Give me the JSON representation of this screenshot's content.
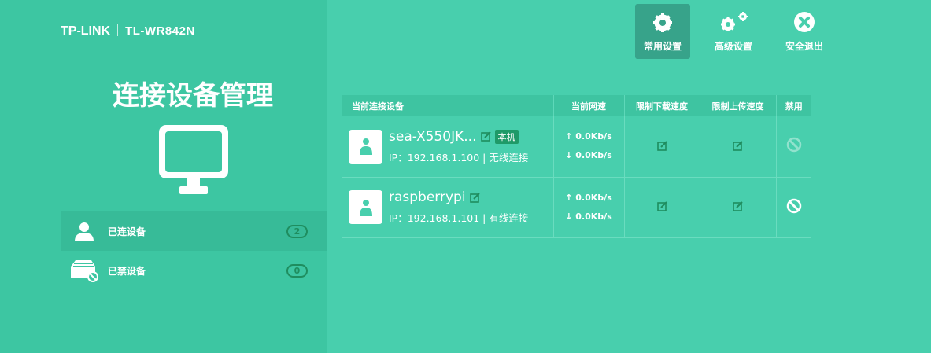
{
  "header": {
    "brand": "TP-LINK",
    "model": "TL-WR842N"
  },
  "sidebar": {
    "title": "连接设备管理",
    "items": [
      {
        "label": "已连设备",
        "count": "2"
      },
      {
        "label": "已禁设备",
        "count": "0"
      }
    ]
  },
  "topnav": [
    {
      "label": "常用设置"
    },
    {
      "label": "高级设置"
    },
    {
      "label": "安全退出"
    }
  ],
  "table": {
    "headers": [
      "当前连接设备",
      "当前网速",
      "限制下载速度",
      "限制上传速度",
      "禁用"
    ],
    "rows": [
      {
        "name": "sea-X550JK...",
        "tag": "本机",
        "ip": "IP：192.168.1.100 | 无线连接",
        "up": "↑ 0.0Kb/s",
        "down": "↓ 0.0Kb/s",
        "blocked_enabled": false
      },
      {
        "name": "raspberrypi",
        "tag": "",
        "ip": "IP：192.168.1.101 | 有线连接",
        "up": "↑ 0.0Kb/s",
        "down": "↓ 0.0Kb/s",
        "blocked_enabled": true
      }
    ]
  },
  "colors": {
    "sidebar": "#3dc6a2",
    "main": "#48cfad",
    "badge": "#1f8d5f"
  }
}
